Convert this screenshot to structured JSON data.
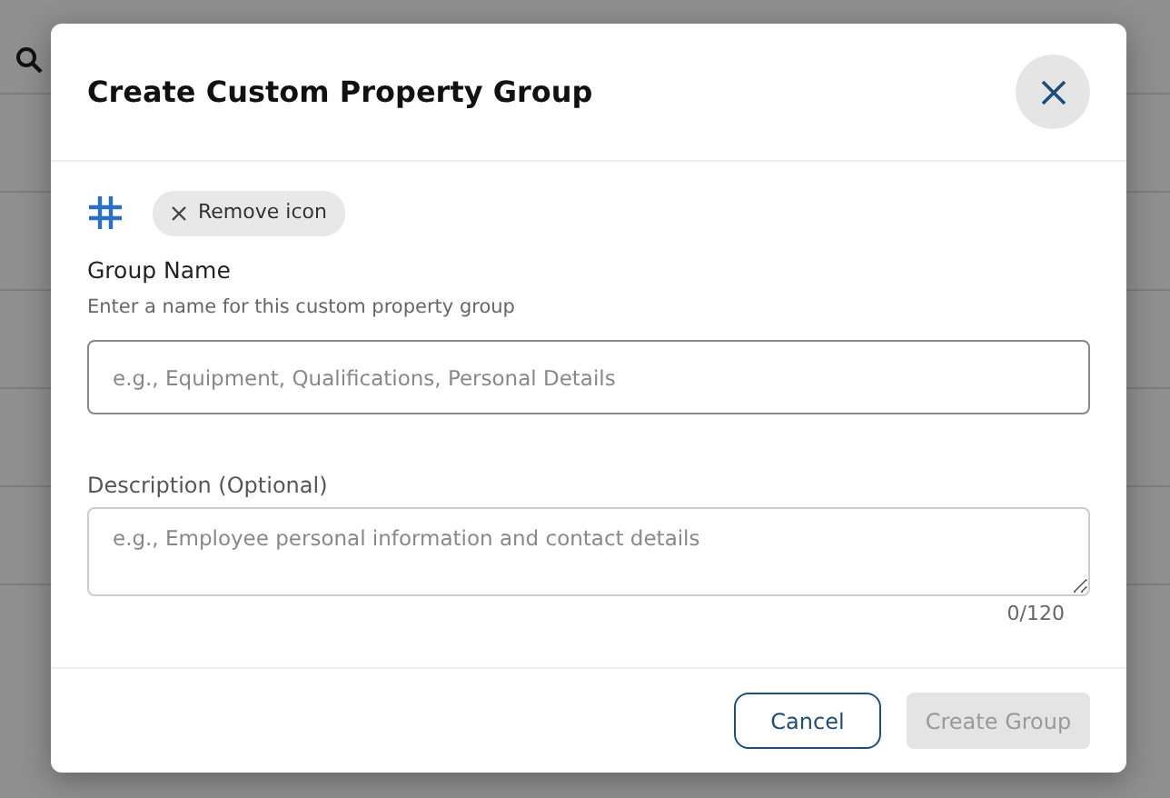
{
  "dialog": {
    "title": "Create Custom Property Group",
    "remove_icon_chip": {
      "label": "Remove icon"
    },
    "fields": [
      {
        "kind": "input",
        "label": "Group Name",
        "help": "Enter a name for this custom property group",
        "placeholder": "e.g., Equipment, Qualifications, Personal Details"
      },
      {
        "kind": "textarea",
        "label": "Description (Optional)",
        "placeholder": "e.g., Employee personal information and contact details",
        "counter": "0/120"
      }
    ],
    "buttons": [
      {
        "label": "Cancel",
        "kind": "secondary",
        "disabled": false
      },
      {
        "label": "Create Group",
        "kind": "primary",
        "disabled": true
      }
    ]
  }
}
